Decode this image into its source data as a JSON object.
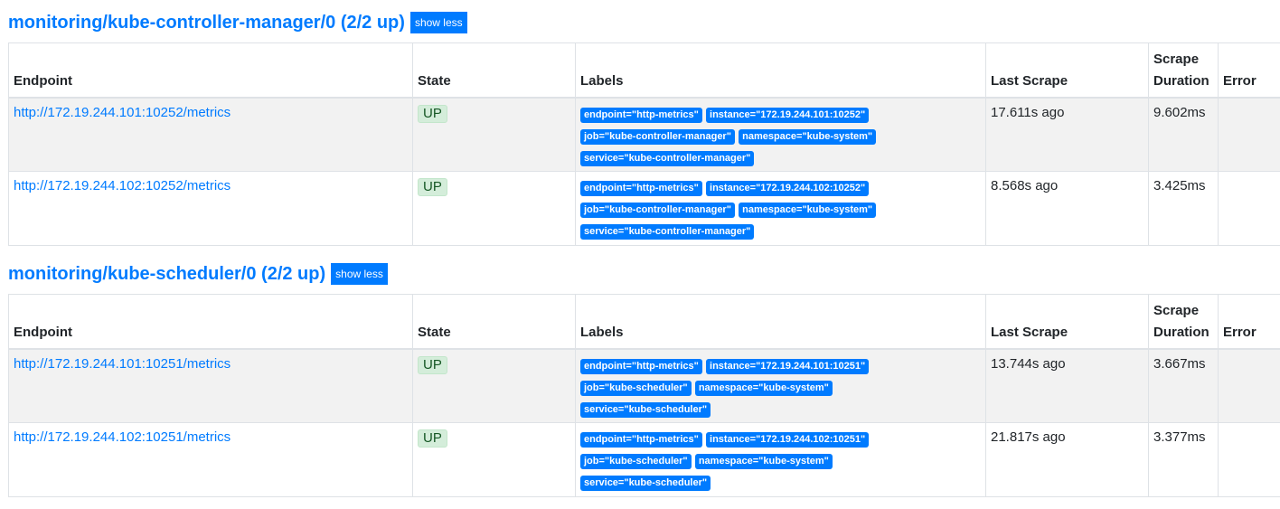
{
  "columns": [
    "Endpoint",
    "State",
    "Labels",
    "Last Scrape",
    "Scrape Duration",
    "Error"
  ],
  "columns_scrape_line1": "Scrape",
  "columns_scrape_line2": "Duration",
  "sections": [
    {
      "title": "monitoring/kube-controller-manager/0 (2/2 up)",
      "toggle_label": "show less",
      "rows": [
        {
          "endpoint": "http://172.19.244.101:10252/metrics",
          "state": "UP",
          "labels": [
            [
              "endpoint=\"http-metrics\"",
              "instance=\"172.19.244.101:10252\""
            ],
            [
              "job=\"kube-controller-manager\"",
              "namespace=\"kube-system\""
            ],
            [
              "service=\"kube-controller-manager\""
            ]
          ],
          "last_scrape": "17.611s ago",
          "duration": "9.602ms",
          "error": ""
        },
        {
          "endpoint": "http://172.19.244.102:10252/metrics",
          "state": "UP",
          "labels": [
            [
              "endpoint=\"http-metrics\"",
              "instance=\"172.19.244.102:10252\""
            ],
            [
              "job=\"kube-controller-manager\"",
              "namespace=\"kube-system\""
            ],
            [
              "service=\"kube-controller-manager\""
            ]
          ],
          "last_scrape": "8.568s ago",
          "duration": "3.425ms",
          "error": ""
        }
      ]
    },
    {
      "title": "monitoring/kube-scheduler/0 (2/2 up)",
      "toggle_label": "show less",
      "rows": [
        {
          "endpoint": "http://172.19.244.101:10251/metrics",
          "state": "UP",
          "labels": [
            [
              "endpoint=\"http-metrics\"",
              "instance=\"172.19.244.101:10251\""
            ],
            [
              "job=\"kube-scheduler\"",
              "namespace=\"kube-system\""
            ],
            [
              "service=\"kube-scheduler\""
            ]
          ],
          "last_scrape": "13.744s ago",
          "duration": "3.667ms",
          "error": ""
        },
        {
          "endpoint": "http://172.19.244.102:10251/metrics",
          "state": "UP",
          "labels": [
            [
              "endpoint=\"http-metrics\"",
              "instance=\"172.19.244.102:10251\""
            ],
            [
              "job=\"kube-scheduler\"",
              "namespace=\"kube-system\""
            ],
            [
              "service=\"kube-scheduler\""
            ]
          ],
          "last_scrape": "21.817s ago",
          "duration": "3.377ms",
          "error": ""
        }
      ]
    }
  ]
}
